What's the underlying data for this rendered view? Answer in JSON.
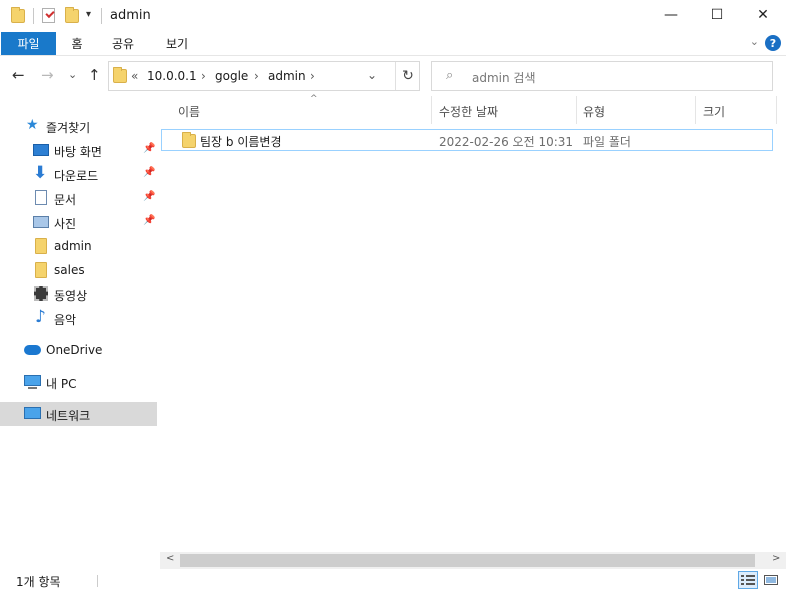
{
  "window": {
    "title": "admin",
    "minimize": "—",
    "maximize": "☐",
    "close": "✕"
  },
  "ribbon": {
    "tabs": [
      {
        "label": "파일",
        "active": true
      },
      {
        "label": "홈",
        "active": false
      },
      {
        "label": "공유",
        "active": false
      },
      {
        "label": "보기",
        "active": false
      }
    ],
    "help": "?",
    "collapse": "⌄"
  },
  "nav": {
    "back": "←",
    "forward": "→",
    "recent": "⌄",
    "up": "↑",
    "address": {
      "overflow": "«",
      "crumbs": [
        "10.0.0.1",
        "gogle",
        "admin"
      ],
      "separator": "›",
      "dropdown": "⌄",
      "refresh": "↻"
    },
    "search": {
      "placeholder": "admin 검색",
      "icon": "⌕"
    }
  },
  "sidebar": {
    "items": [
      {
        "label": "즐겨찾기",
        "icon": "star-icon",
        "pinned": false
      },
      {
        "label": "바탕 화면",
        "icon": "desktop-icon",
        "pinned": true
      },
      {
        "label": "다운로드",
        "icon": "download-icon",
        "pinned": true
      },
      {
        "label": "문서",
        "icon": "document-icon",
        "pinned": true
      },
      {
        "label": "사진",
        "icon": "picture-icon",
        "pinned": true
      },
      {
        "label": "admin",
        "icon": "folder-icon",
        "pinned": false
      },
      {
        "label": "sales",
        "icon": "folder-icon",
        "pinned": false
      },
      {
        "label": "동영상",
        "icon": "video-icon",
        "pinned": false
      },
      {
        "label": "음악",
        "icon": "music-icon",
        "pinned": false
      },
      {
        "label": "OneDrive",
        "icon": "cloud-icon",
        "pinned": false
      },
      {
        "label": "내 PC",
        "icon": "pc-icon",
        "pinned": false
      },
      {
        "label": "네트워크",
        "icon": "network-icon",
        "pinned": false,
        "selected": true
      }
    ],
    "pin_glyph": "📌"
  },
  "columns": [
    {
      "label": "이름",
      "sorted": true
    },
    {
      "label": "수정한 날짜"
    },
    {
      "label": "유형"
    },
    {
      "label": "크기"
    }
  ],
  "sort_glyph": "^",
  "files": [
    {
      "name": "팀장 b 이름변경",
      "modified": "2022-02-26 오전 10:31",
      "type": "파일 폴더",
      "size": ""
    }
  ],
  "scroll": {
    "left": "<",
    "right": ">"
  },
  "status": {
    "count": "1개 항목"
  },
  "colors": {
    "accent": "#1979ca",
    "selection_border": "#99d1ff",
    "folder": "#f5d36c"
  }
}
